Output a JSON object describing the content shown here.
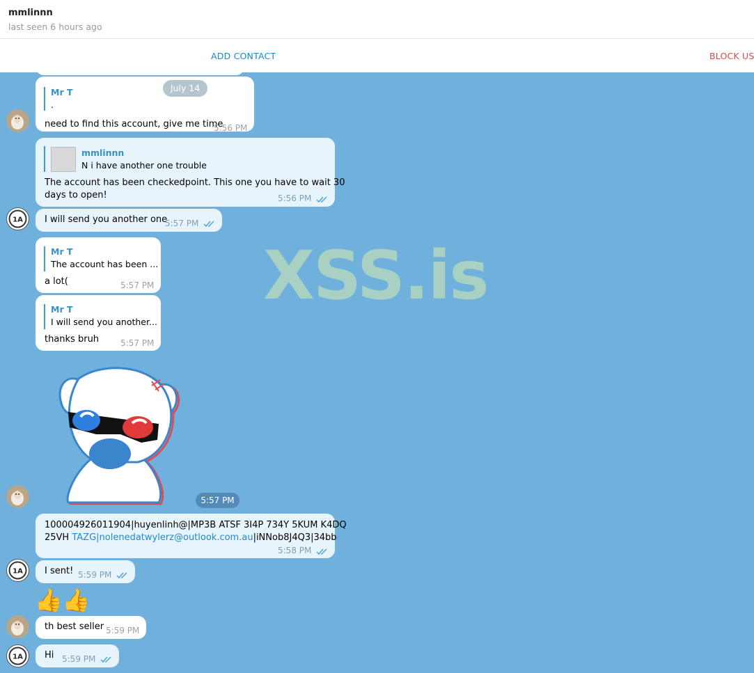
{
  "header": {
    "contact_name": "mmlinnn",
    "last_seen": "last seen 6 hours ago"
  },
  "actions": {
    "add_contact": "ADD CONTACT",
    "block_user": "BLOCK USE"
  },
  "watermark": "XSS.is",
  "date_separator": "July 14",
  "messages": [
    {
      "reply_name": "Mr T",
      "reply_text": ".",
      "text": "need to find this account, give me time",
      "time": "5:56 PM"
    },
    {
      "reply_name": "mmlinnn",
      "reply_text": "N i have another one trouble",
      "text_line1": "The account has been checkedpoint. This one you have to wait 30",
      "text_line2": "days to open!",
      "time": "5:56 PM"
    },
    {
      "text": "I will send you another one",
      "time": "5:57 PM"
    },
    {
      "reply_name": "Mr T",
      "reply_text": "The account has been ...",
      "text": "a lot(",
      "time": "5:57 PM"
    },
    {
      "reply_name": "Mr T",
      "reply_text": "I will send you another...",
      "text": "thanks bruh",
      "time": "5:57 PM"
    },
    {
      "sticker": "bear-3d-glasses",
      "time": "5:57 PM"
    },
    {
      "text_line1": "100004926011904|huyenlinh@|MP3B ATSF 3I4P 734Y 5KUM K4DQ",
      "text_line2_prefix": "25VH ",
      "text_line2_link": "TAZG|nolenedatwylerz@outlook.com.au",
      "text_line2_suffix": "|iNNob8J4Q3|34bb",
      "time": "5:58 PM"
    },
    {
      "text": "I sent!",
      "time": "5:59 PM"
    },
    {
      "emoji": "👍👍"
    },
    {
      "text": "th best seller",
      "time": "5:59 PM"
    },
    {
      "text": "Hi",
      "time": "5:59 PM"
    }
  ],
  "colors": {
    "chat_background": "#6fb0dd",
    "accent": "#168acd",
    "danger": "#d14e4e",
    "watermark": "#a8d0c3"
  }
}
